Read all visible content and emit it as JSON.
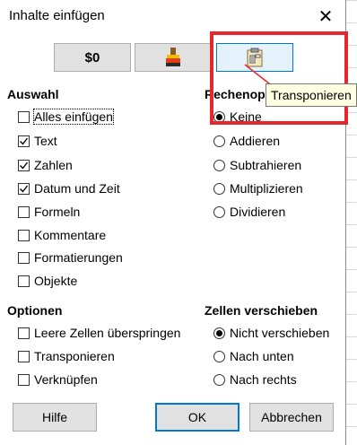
{
  "dialog": {
    "title": "Inhalte einfügen",
    "close_icon": "close-icon"
  },
  "presets": [
    {
      "label": "$0",
      "icon": "values-only"
    },
    {
      "icon": "formats-paintbrush-icon"
    },
    {
      "icon": "transpose-clipboard-icon"
    }
  ],
  "tooltip": "Transponieren",
  "auswahl": {
    "heading": "Auswahl",
    "items": [
      {
        "label": "Alles einfügen",
        "checked": false
      },
      {
        "label": "Text",
        "checked": true
      },
      {
        "label": "Zahlen",
        "checked": true
      },
      {
        "label": "Datum und Zeit",
        "checked": true
      },
      {
        "label": "Formeln",
        "checked": false
      },
      {
        "label": "Kommentare",
        "checked": false
      },
      {
        "label": "Formatierungen",
        "checked": false
      },
      {
        "label": "Objekte",
        "checked": false
      }
    ]
  },
  "rechen": {
    "heading": "Rechenop",
    "items": [
      {
        "label": "Keine",
        "selected": true
      },
      {
        "label": "Addieren",
        "selected": false
      },
      {
        "label": "Subtrahieren",
        "selected": false
      },
      {
        "label": "Multiplizieren",
        "selected": false
      },
      {
        "label": "Dividieren",
        "selected": false
      }
    ]
  },
  "optionen": {
    "heading": "Optionen",
    "items": [
      {
        "label": "Leere Zellen überspringen",
        "checked": false
      },
      {
        "label": "Transponieren",
        "checked": false
      },
      {
        "label": "Verknüpfen",
        "checked": false
      }
    ]
  },
  "zellen": {
    "heading": "Zellen verschieben",
    "items": [
      {
        "label": "Nicht verschieben",
        "selected": true
      },
      {
        "label": "Nach unten",
        "selected": false
      },
      {
        "label": "Nach rechts",
        "selected": false
      }
    ]
  },
  "buttons": {
    "help": "Hilfe",
    "ok": "OK",
    "cancel": "Abbrechen"
  },
  "colors": {
    "highlight": "#e8262d",
    "accent": "#0078d7",
    "tooltip_bg": "#ffffe1"
  }
}
